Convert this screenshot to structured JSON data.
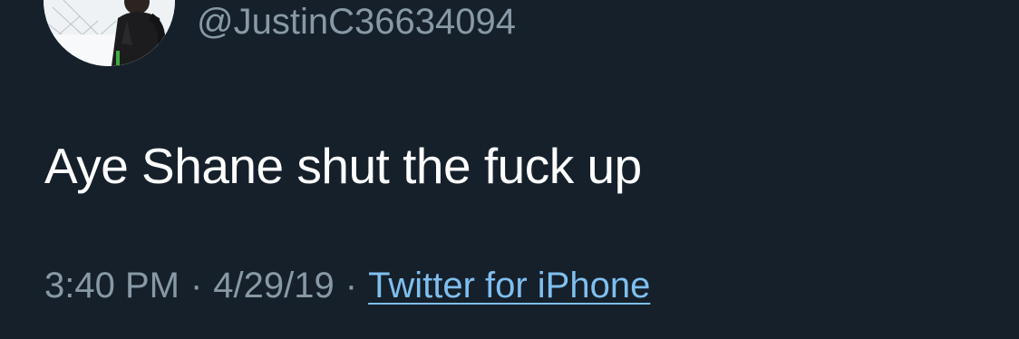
{
  "tweet": {
    "handle": "@JustinC36634094",
    "text": "Aye Shane shut the fuck up",
    "time": "3:40 PM",
    "separator": "·",
    "date": "4/29/19",
    "source": "Twitter for iPhone"
  },
  "colors": {
    "background": "#15202b",
    "text_primary": "#ffffff",
    "text_secondary": "#8899a6",
    "link": "#7fbfee"
  }
}
